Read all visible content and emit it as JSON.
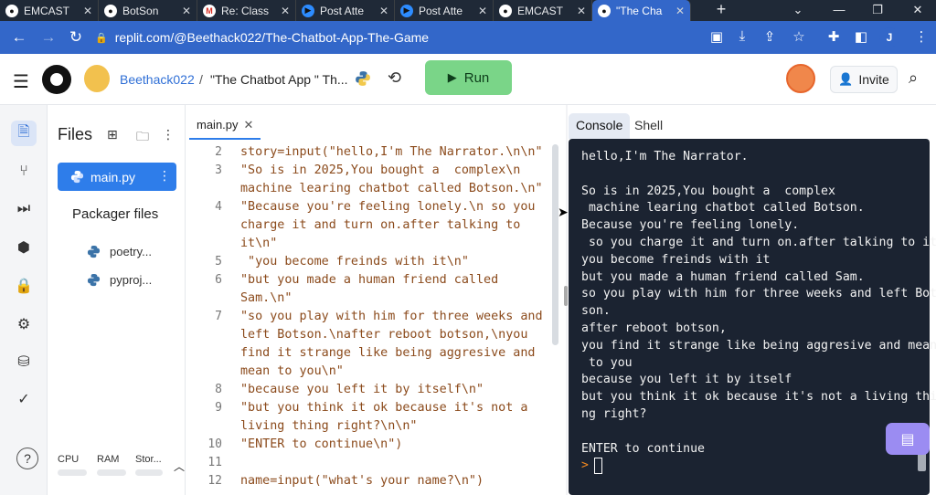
{
  "browser": {
    "tabs": [
      {
        "title": "EMCAST",
        "favicon": "chrome-icon"
      },
      {
        "title": "BotSon",
        "favicon": "replit-icon"
      },
      {
        "title": "Re: Class",
        "favicon": "gmail-icon"
      },
      {
        "title": "Post Atte",
        "favicon": "zoom-icon"
      },
      {
        "title": "Post Atte",
        "favicon": "zoom-icon"
      },
      {
        "title": "EMCAST",
        "favicon": "chrome-icon"
      },
      {
        "title": "\"The Cha",
        "favicon": "replit-icon",
        "active": true
      }
    ],
    "url": "replit.com/@Beethack022/The-Chatbot-App-The-Game",
    "profile_initial": "J"
  },
  "header": {
    "username": "Beethack022",
    "separator": "/",
    "repl_name": "\"The Chatbot App \" Th...",
    "run_label": "Run",
    "invite_label": "Invite"
  },
  "files": {
    "title": "Files",
    "active_file": "main.py",
    "packager_title": "Packager files",
    "packager_items": [
      "poetry...",
      "pyproj..."
    ],
    "resources": [
      "CPU",
      "RAM",
      "Stor..."
    ]
  },
  "editor": {
    "tab_label": "main.py",
    "lines": [
      {
        "num": "2",
        "text": "story=input(\"hello,I'm The Narrator.\\n\\n\""
      },
      {
        "num": "3",
        "text": "\"So is in 2025,You bought a  complex\\n"
      },
      {
        "num": "",
        "text": "machine learing chatbot called Botson.\\n\""
      },
      {
        "num": "4",
        "text": "\"Because you're feeling lonely.\\n so you"
      },
      {
        "num": "",
        "text": "charge it and turn on.after talking to"
      },
      {
        "num": "",
        "text": "it\\n\""
      },
      {
        "num": "5",
        "text": " \"you become freinds with it\\n\""
      },
      {
        "num": "6",
        "text": "\"but you made a human friend called"
      },
      {
        "num": "",
        "text": "Sam.\\n\""
      },
      {
        "num": "7",
        "text": "\"so you play with him for three weeks and"
      },
      {
        "num": "",
        "text": "left Botson.\\nafter reboot botson,\\nyou"
      },
      {
        "num": "",
        "text": "find it strange like being aggresive and"
      },
      {
        "num": "",
        "text": "mean to you\\n\""
      },
      {
        "num": "8",
        "text": "\"because you left it by itself\\n\""
      },
      {
        "num": "9",
        "text": "\"but you think it ok because it's not a"
      },
      {
        "num": "",
        "text": "living thing right?\\n\\n\""
      },
      {
        "num": "10",
        "text": "\"ENTER to continue\\n\")"
      },
      {
        "num": "11",
        "text": ""
      },
      {
        "num": "12",
        "text": "name=input(\"what's your name?\\n\")"
      }
    ]
  },
  "console": {
    "tabs": [
      "Console",
      "Shell"
    ],
    "output": [
      "hello,I'm The Narrator.",
      "",
      "So is in 2025,You bought a  complex",
      " machine learing chatbot called Botson.",
      "Because you're feeling lonely.",
      " so you charge it and turn on.after talking to it",
      "you become freinds with it",
      "but you made a human friend called Sam.",
      "so you play with him for three weeks and left Bot",
      "son.",
      "after reboot botson,",
      "you find it strange like being aggresive and mean",
      " to you",
      "because you left it by itself",
      "but you think it ok because it's not a living thi",
      "ng right?",
      "",
      "ENTER to continue"
    ],
    "prompt": ">"
  }
}
